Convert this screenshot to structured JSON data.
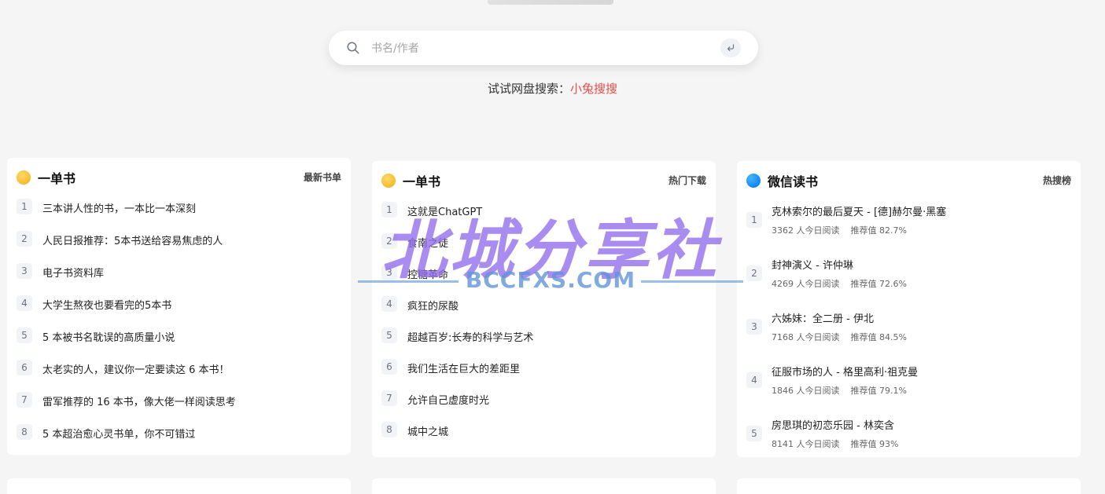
{
  "search": {
    "placeholder": "书名/作者"
  },
  "suggestion": {
    "prefix": "试试网盘搜索：",
    "link": "小兔搜搜"
  },
  "cards": [
    {
      "title": "一单书",
      "tag": "最新书单",
      "items": [
        {
          "rank": "1",
          "text": "三本讲人性的书，一本比一本深刻"
        },
        {
          "rank": "2",
          "text": "人民日报推荐：5本书送给容易焦虑的人"
        },
        {
          "rank": "3",
          "text": "电子书资料库"
        },
        {
          "rank": "4",
          "text": "大学生熬夜也要看完的5本书"
        },
        {
          "rank": "5",
          "text": "5 本被书名耽误的高质量小说"
        },
        {
          "rank": "6",
          "text": "太老实的人，建议你一定要读这 6 本书！"
        },
        {
          "rank": "7",
          "text": "雷军推荐的 16 本书，像大佬一样阅读思考"
        },
        {
          "rank": "8",
          "text": "5 本超治愈心灵书单，你不可错过"
        }
      ]
    },
    {
      "title": "一单书",
      "tag": "热门下载",
      "items": [
        {
          "rank": "1",
          "text": "这就是ChatGPT"
        },
        {
          "rank": "2",
          "text": "食南之徒"
        },
        {
          "rank": "3",
          "text": "控糖革命"
        },
        {
          "rank": "4",
          "text": "疯狂的尿酸"
        },
        {
          "rank": "5",
          "text": "超越百岁:长寿的科学与艺术"
        },
        {
          "rank": "6",
          "text": "我们生活在巨大的差距里"
        },
        {
          "rank": "7",
          "text": "允许自己虚度时光"
        },
        {
          "rank": "8",
          "text": "城中之城"
        }
      ]
    },
    {
      "title": "微信读书",
      "tag": "热搜榜",
      "items": [
        {
          "rank": "1",
          "title": "克林索尔的最后夏天 - [德]赫尔曼·黑塞",
          "reads": "3362 人今日阅读",
          "score": "推荐值 82.7%"
        },
        {
          "rank": "2",
          "title": "封神演义 - 许仲琳",
          "reads": "4269 人今日阅读",
          "score": "推荐值 72.6%"
        },
        {
          "rank": "3",
          "title": "六姊妹：全二册 - 伊北",
          "reads": "7168 人今日阅读",
          "score": "推荐值 84.5%"
        },
        {
          "rank": "4",
          "title": "征服市场的人 - 格里高利·祖克曼",
          "reads": "1846 人今日阅读",
          "score": "推荐值 79.1%"
        },
        {
          "rank": "5",
          "title": "房思琪的初恋乐园 - 林奕含",
          "reads": "8141 人今日阅读",
          "score": "推荐值 93%"
        }
      ]
    }
  ],
  "watermark": {
    "main": "北城分享社",
    "sub": "BCCFXS.COM"
  },
  "icons": {
    "search": "search-icon",
    "enter": "enter-icon",
    "logo_yellow": "yellow-book-logo",
    "logo_blue": "wechat-read-logo"
  },
  "colors": {
    "accent": "#ea4c4c",
    "yellow": "#f7c031",
    "blue": "#1489f3",
    "watermark_purple": "#926feb",
    "watermark_blue": "#5e94d6"
  }
}
